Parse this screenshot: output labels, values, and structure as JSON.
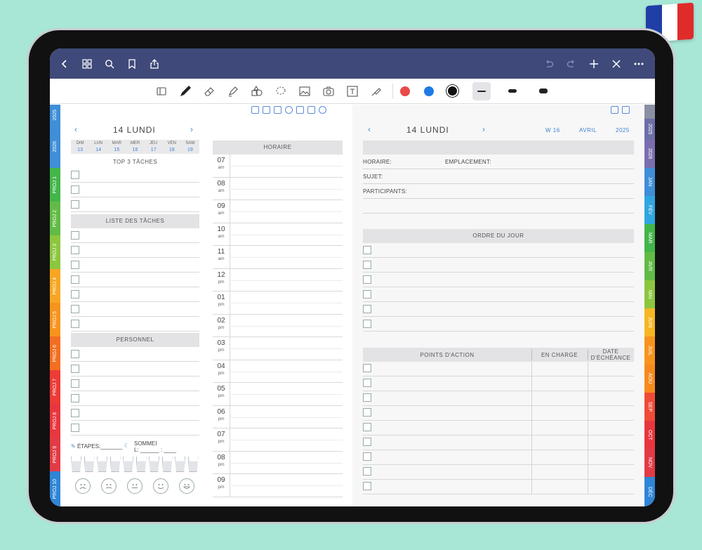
{
  "flag_colors": [
    "#1f3fa6",
    "#ffffff",
    "#e02b2b"
  ],
  "topbar": {
    "color": "#3f4a7a",
    "left_icons": [
      "back-icon",
      "grid-icon",
      "search-icon",
      "bookmark-icon",
      "share-icon"
    ],
    "right_icons": [
      "undo-icon",
      "redo-icon",
      "plus-icon",
      "close-icon",
      "more-icon"
    ]
  },
  "toolbar": {
    "tools": [
      "readmode-icon",
      "pen-icon",
      "eraser-icon",
      "highlighter-icon",
      "shapes-icon",
      "lasso-icon",
      "image-icon",
      "camera-icon",
      "text-icon",
      "tape-icon"
    ],
    "colors": [
      "#e84a4a",
      "#1e7be6",
      "#111111"
    ]
  },
  "left_tabs": [
    {
      "label": "2025",
      "color": "#3f8ed8"
    },
    {
      "label": "2026",
      "color": "#3f8ed8"
    },
    {
      "label": "PROJ 1",
      "color": "#43b649"
    },
    {
      "label": "PROJ 2",
      "color": "#62bb46"
    },
    {
      "label": "PROJ 3",
      "color": "#8cc63f"
    },
    {
      "label": "PROJ 4",
      "color": "#f6a623"
    },
    {
      "label": "PROJ 5",
      "color": "#f7941d"
    },
    {
      "label": "PROJ 6",
      "color": "#f26f21"
    },
    {
      "label": "PROJ 7",
      "color": "#ed3b36"
    },
    {
      "label": "PROJ 8",
      "color": "#e8363e"
    },
    {
      "label": "PROJ 9",
      "color": "#e23b45"
    },
    {
      "label": "PROJ 10",
      "color": "#2f86d6"
    }
  ],
  "right_tabs": [
    {
      "label": "",
      "color": "#8a8fa3"
    },
    {
      "label": "2025",
      "color": "#6c6fa8"
    },
    {
      "label": "2026",
      "color": "#7b6eb0"
    },
    {
      "label": "JAN",
      "color": "#3f8ed8"
    },
    {
      "label": "FÉV",
      "color": "#2fa6e0"
    },
    {
      "label": "MAR",
      "color": "#43b649"
    },
    {
      "label": "AVR",
      "color": "#62bb46"
    },
    {
      "label": "MAI",
      "color": "#8cc63f"
    },
    {
      "label": "JUIN",
      "color": "#f6b623"
    },
    {
      "label": "JUIL",
      "color": "#f7941d"
    },
    {
      "label": "AOÛ",
      "color": "#f68a1f"
    },
    {
      "label": "SEP",
      "color": "#ef4b37"
    },
    {
      "label": "OCT",
      "color": "#e8363e"
    },
    {
      "label": "NOV",
      "color": "#e23b45"
    },
    {
      "label": "DÉC",
      "color": "#2f86d6"
    }
  ],
  "left": {
    "nav_icons": [
      "home-icon",
      "mail-icon",
      "clipboard-icon",
      "target-icon",
      "wallet-icon",
      "document-icon",
      "pie-icon"
    ],
    "day_title": "14 LUNDI",
    "prev": "‹",
    "next": "›",
    "week": [
      {
        "d": "DIM",
        "n": "13"
      },
      {
        "d": "LUN",
        "n": "14"
      },
      {
        "d": "MAR",
        "n": "15"
      },
      {
        "d": "MER",
        "n": "16"
      },
      {
        "d": "JEU",
        "n": "17"
      },
      {
        "d": "VEN",
        "n": "18"
      },
      {
        "d": "SAM",
        "n": "19"
      }
    ],
    "top3": "TOP 3 TÂCHES",
    "tasks": "LISTE DES TÂCHES",
    "personal": "PERSONNEL",
    "horaire": "HORAIRE",
    "hours": [
      {
        "h": "07",
        "p": "am"
      },
      {
        "h": "08",
        "p": "am"
      },
      {
        "h": "09",
        "p": "am"
      },
      {
        "h": "10",
        "p": "am"
      },
      {
        "h": "11",
        "p": "am"
      },
      {
        "h": "12",
        "p": "pm"
      },
      {
        "h": "01",
        "p": "pm"
      },
      {
        "h": "02",
        "p": "pm"
      },
      {
        "h": "03",
        "p": "pm"
      },
      {
        "h": "04",
        "p": "pm"
      },
      {
        "h": "05",
        "p": "pm"
      },
      {
        "h": "06",
        "p": "pm"
      },
      {
        "h": "07",
        "p": "pm"
      },
      {
        "h": "08",
        "p": "pm"
      },
      {
        "h": "09",
        "p": "pm"
      }
    ],
    "steps": "ÉTAPES:",
    "sleep_1": "SOMMEI",
    "sleep_2": "L:"
  },
  "right": {
    "nav_icons": [
      "layout-icon",
      "export-icon"
    ],
    "day_title": "14 LUNDI",
    "prev": "‹",
    "next": "›",
    "week": "W 16",
    "month": "AVRIL",
    "year": "2025",
    "horaire": "HORAIRE:",
    "location": "EMPLACEMENT:",
    "subject": "SUJET:",
    "participants": "PARTICIPANTS:",
    "agenda": "ORDRE DU JOUR",
    "actions": "POINTS D'ACTION",
    "owner": "EN CHARGE",
    "due_1": "DATE",
    "due_2": "D'ÉCHÉANCE"
  }
}
